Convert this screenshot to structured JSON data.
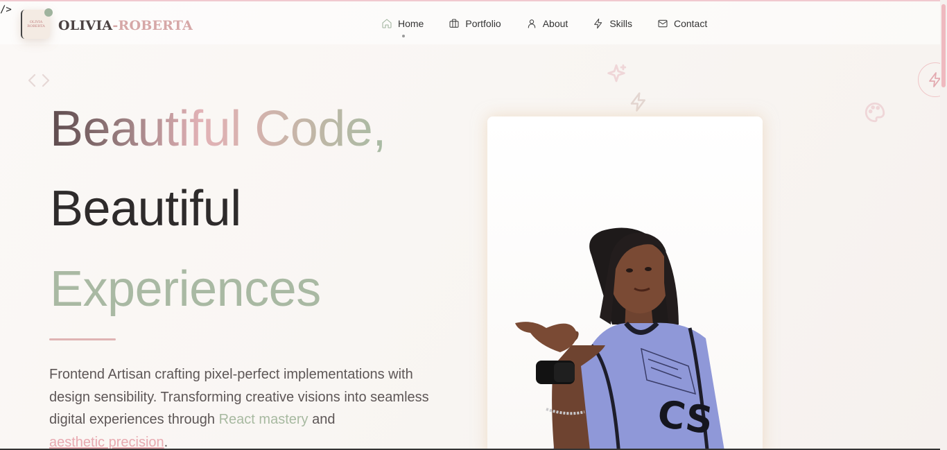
{
  "stray_text": "/>",
  "brand": {
    "part1": "OLIVIA",
    "part2": "-ROBERTA",
    "logo_text_top": "OLIVIA",
    "logo_text_bottom": "ROBERTA"
  },
  "nav": {
    "items": [
      {
        "label": "Home",
        "icon": "home-icon"
      },
      {
        "label": "Portfolio",
        "icon": "briefcase-icon"
      },
      {
        "label": "About",
        "icon": "user-icon"
      },
      {
        "label": "Skills",
        "icon": "bolt-icon"
      },
      {
        "label": "Contact",
        "icon": "mail-icon"
      }
    ],
    "active": "Home"
  },
  "hero": {
    "line1": "Beautiful Code,",
    "line2": "Beautiful",
    "line3": "Experiences",
    "description_part1": "Frontend Artisan crafting pixel-perfect implementations with design sensibility. Transforming creative visions into seamless digital experiences through ",
    "highlight1": "React mastery",
    "description_part2": " and",
    "highlight2": "aesthetic precision",
    "description_end": "."
  },
  "colors": {
    "accent_green": "#a7b9a0",
    "accent_pink": "#e8a9b0",
    "text_dark": "#2e2b2b"
  }
}
